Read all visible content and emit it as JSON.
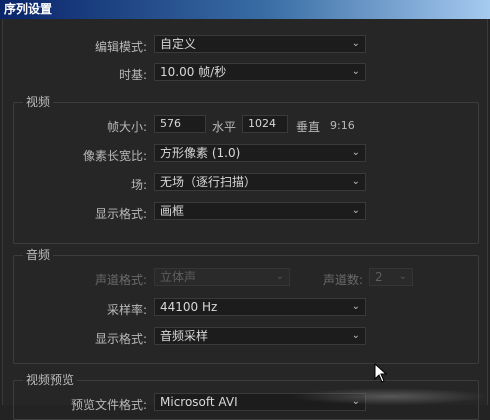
{
  "window": {
    "title": "序列设置"
  },
  "general": {
    "edit_mode_label": "编辑模式:",
    "edit_mode_value": "自定义",
    "timebase_label": "时基:",
    "timebase_value": "10.00  帧/秒"
  },
  "video": {
    "title": "视频",
    "frame_size_label": "帧大小:",
    "frame_width": "576",
    "horizontal_label": "水平",
    "frame_height": "1024",
    "vertical_label": "垂直",
    "aspect_ratio": "9:16",
    "pixel_aspect_label": "像素长宽比:",
    "pixel_aspect_value": "方形像素 (1.0)",
    "field_label": "场:",
    "field_value": "无场（逐行扫描）",
    "display_format_label": "显示格式:",
    "display_format_value": "画框"
  },
  "audio": {
    "title": "音频",
    "channel_format_label": "声道格式:",
    "channel_format_value": "立体声",
    "channel_count_label": "声道数:",
    "channel_count_value": "2",
    "sample_rate_label": "采样率:",
    "sample_rate_value": "44100 Hz",
    "display_format_label": "显示格式:",
    "display_format_value": "音频采样"
  },
  "video_preview": {
    "title": "视频预览",
    "file_format_label": "预览文件格式:",
    "file_format_value": "Microsoft AVI"
  },
  "icons": {
    "dropdown": "chevron-down-icon",
    "pointer": "mouse-cursor-icon"
  },
  "colors": {
    "titlebar_start": "#0a246a",
    "titlebar_end": "#a6caf0",
    "panel_bg": "#262626"
  }
}
